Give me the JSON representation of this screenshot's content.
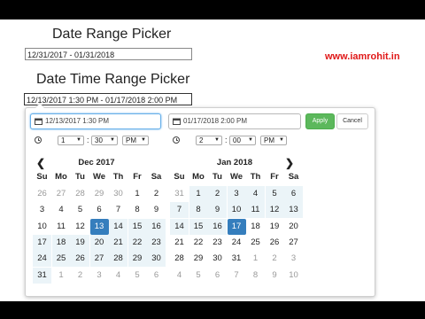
{
  "page": {
    "heading_date_range": "Date Range Picker",
    "heading_date_time_range": "Date Time Range Picker",
    "date_range_value": "12/31/2017 - 01/31/2018",
    "date_time_range_value": "12/13/2017 1:30 PM - 01/17/2018 2:00 PM",
    "brand": "www.iamrohit.in"
  },
  "picker": {
    "start_input": "12/13/2017 1:30 PM",
    "end_input": "01/17/2018 2:00 PM",
    "apply_label": "Apply",
    "cancel_label": "Cancel",
    "left_time": {
      "hour": "1",
      "minute": "30",
      "ampm": "PM"
    },
    "right_time": {
      "hour": "2",
      "minute": "00",
      "ampm": "PM"
    },
    "nav_prev": "❮",
    "nav_next": "❯",
    "weekdays": [
      "Su",
      "Mo",
      "Tu",
      "We",
      "Th",
      "Fr",
      "Sa"
    ],
    "left": {
      "month": "Dec 2017",
      "days": [
        [
          "26",
          "27",
          "28",
          "29",
          "30",
          "1",
          "2"
        ],
        [
          "3",
          "4",
          "5",
          "6",
          "7",
          "8",
          "9"
        ],
        [
          "10",
          "11",
          "12",
          "13",
          "14",
          "15",
          "16"
        ],
        [
          "17",
          "18",
          "19",
          "20",
          "21",
          "22",
          "23"
        ],
        [
          "24",
          "25",
          "26",
          "27",
          "28",
          "29",
          "30"
        ],
        [
          "31",
          "1",
          "2",
          "3",
          "4",
          "5",
          "6"
        ]
      ],
      "off": [
        [
          0,
          0
        ],
        [
          0,
          1
        ],
        [
          0,
          2
        ],
        [
          0,
          3
        ],
        [
          0,
          4
        ],
        [
          5,
          1
        ],
        [
          5,
          2
        ],
        [
          5,
          3
        ],
        [
          5,
          4
        ],
        [
          5,
          5
        ],
        [
          5,
          6
        ]
      ],
      "selected": [
        [
          2,
          3
        ]
      ],
      "range_start": [
        2,
        3
      ]
    },
    "right": {
      "month": "Jan 2018",
      "days": [
        [
          "31",
          "1",
          "2",
          "3",
          "4",
          "5",
          "6"
        ],
        [
          "7",
          "8",
          "9",
          "10",
          "11",
          "12",
          "13"
        ],
        [
          "14",
          "15",
          "16",
          "17",
          "18",
          "19",
          "20"
        ],
        [
          "21",
          "22",
          "23",
          "24",
          "25",
          "26",
          "27"
        ],
        [
          "28",
          "29",
          "30",
          "31",
          "1",
          "2",
          "3"
        ],
        [
          "4",
          "5",
          "6",
          "7",
          "8",
          "9",
          "10"
        ]
      ],
      "off": [
        [
          0,
          0
        ],
        [
          4,
          4
        ],
        [
          4,
          5
        ],
        [
          4,
          6
        ],
        [
          5,
          0
        ],
        [
          5,
          1
        ],
        [
          5,
          2
        ],
        [
          5,
          3
        ],
        [
          5,
          4
        ],
        [
          5,
          5
        ],
        [
          5,
          6
        ]
      ],
      "selected": [
        [
          2,
          3
        ]
      ],
      "range_end": [
        2,
        3
      ]
    }
  }
}
